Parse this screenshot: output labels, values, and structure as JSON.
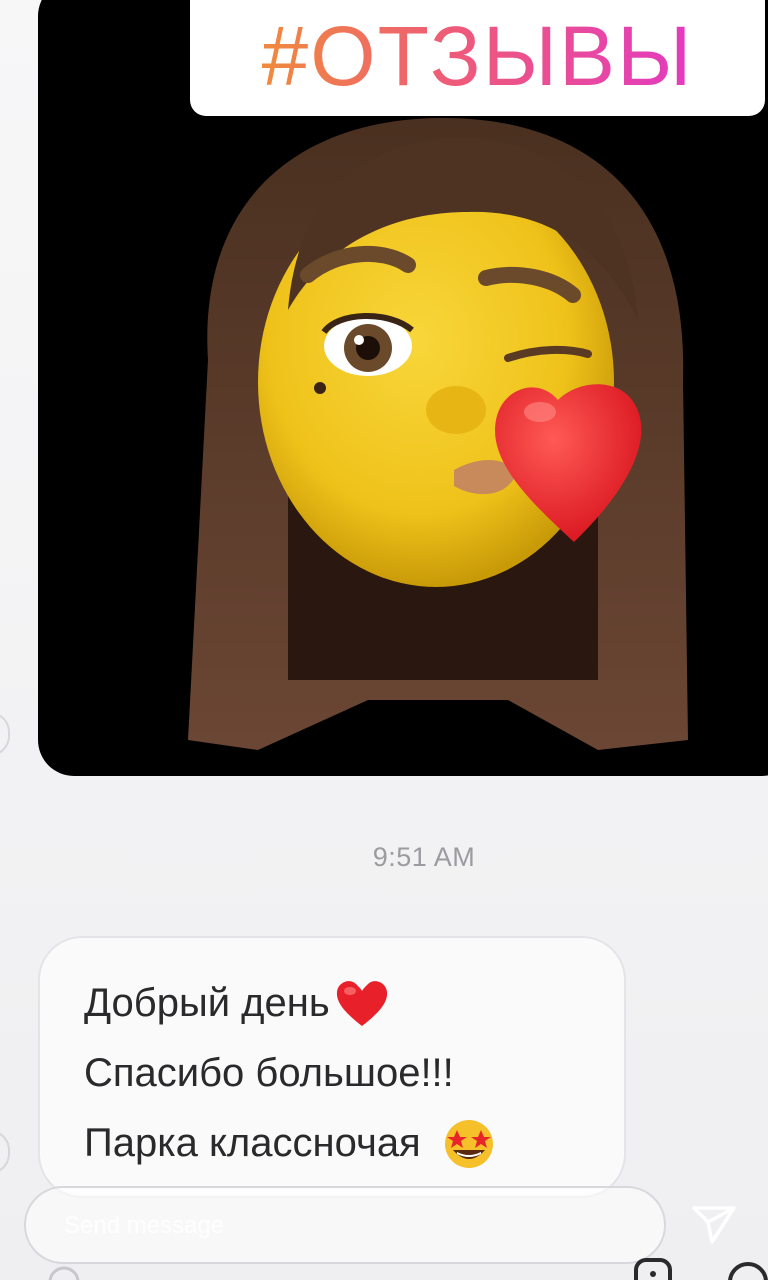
{
  "story": {
    "hashtag": "#ОТЗЫВЫ",
    "hashtag_gradient": [
      "#f08a3d",
      "#ee5a7a",
      "#e33ac0"
    ]
  },
  "chat": {
    "image_message": {
      "content": "memoji-kiss-sticker"
    },
    "timestamp": "9:51 AM",
    "message_lines": [
      {
        "text": "Добрый день",
        "emoji": "red-heart-emoji"
      },
      {
        "text": "Спасибо большое!!!",
        "emoji": ""
      },
      {
        "text": "Парка классночая",
        "emoji": "star-struck-emoji"
      }
    ]
  },
  "composer": {
    "placeholder": "Send message",
    "send_icon": "paper-plane-icon"
  },
  "colors": {
    "heart": "#e8202a",
    "skin": "#f2c51c",
    "hair": "#5a3b2a"
  }
}
